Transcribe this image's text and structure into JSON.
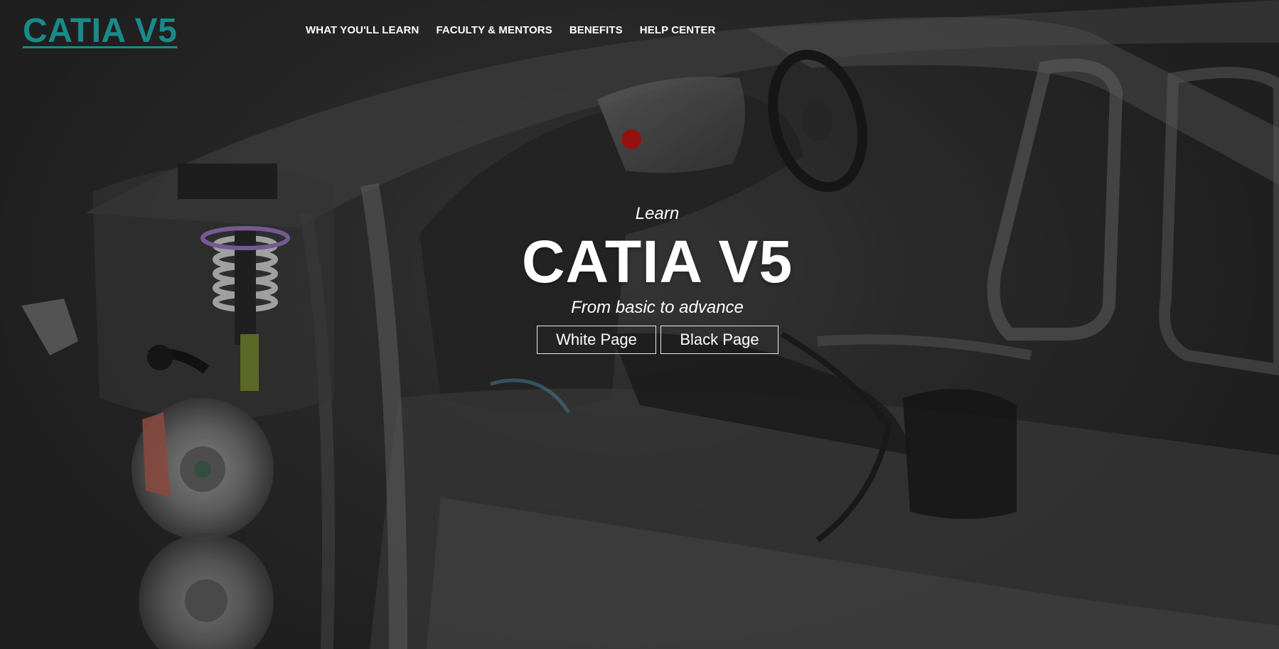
{
  "header": {
    "logo": "CATIA V5",
    "nav": [
      {
        "label": "WHAT YOU'LL LEARN"
      },
      {
        "label": "FACULTY & MENTORS"
      },
      {
        "label": "BENEFITS"
      },
      {
        "label": "HELP CENTER"
      }
    ]
  },
  "hero": {
    "kicker": "Learn",
    "title": "CATIA V5",
    "subtitle": "From basic to advance",
    "buttons": {
      "white": "White Page",
      "black": "Black Page"
    },
    "background_image": "car-body-in-white-cad-render"
  },
  "colors": {
    "logo": "#1a8a8a",
    "text": "#ffffff",
    "background": "#2a2a2a"
  }
}
